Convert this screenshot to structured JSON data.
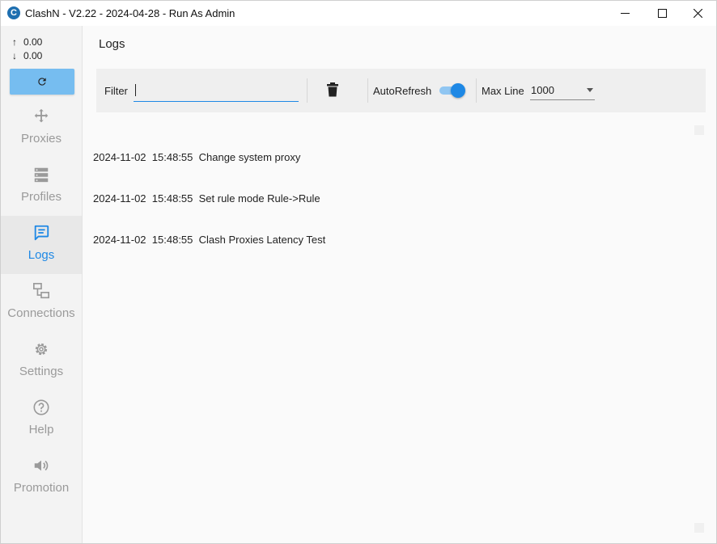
{
  "window": {
    "title": "ClashN - V2.22 - 2024-04-28 - Run As Admin",
    "app_icon_letter": "C"
  },
  "traffic": {
    "up": "0.00",
    "down": "0.00",
    "up_arrow": "↑",
    "down_arrow": "↓"
  },
  "nav": {
    "items": [
      {
        "label": "Proxies",
        "icon": "proxies-icon"
      },
      {
        "label": "Profiles",
        "icon": "profiles-icon"
      },
      {
        "label": "Logs",
        "icon": "logs-icon",
        "active": true
      },
      {
        "label": "Connections",
        "icon": "connections-icon"
      },
      {
        "label": "Settings",
        "icon": "gear-icon"
      },
      {
        "label": "Help",
        "icon": "help-icon"
      },
      {
        "label": "Promotion",
        "icon": "speaker-icon"
      }
    ]
  },
  "page": {
    "title": "Logs"
  },
  "toolbar": {
    "filter_label": "Filter",
    "filter_value": "",
    "autorefresh_label": "AutoRefresh",
    "autorefresh_on": true,
    "maxline_label": "Max Line",
    "maxline_value": "1000"
  },
  "logs": [
    {
      "date": "2024-11-02",
      "time": "15:48:55",
      "message": "Change system proxy"
    },
    {
      "date": "2024-11-02",
      "time": "15:48:55",
      "message": "Set rule mode Rule->Rule"
    },
    {
      "date": "2024-11-02",
      "time": "15:48:55",
      "message": "Clash Proxies Latency Test"
    }
  ],
  "colors": {
    "accent": "#1e88e5",
    "refresh_button": "#76bdf0",
    "inactive_text": "#9a9a9a"
  }
}
